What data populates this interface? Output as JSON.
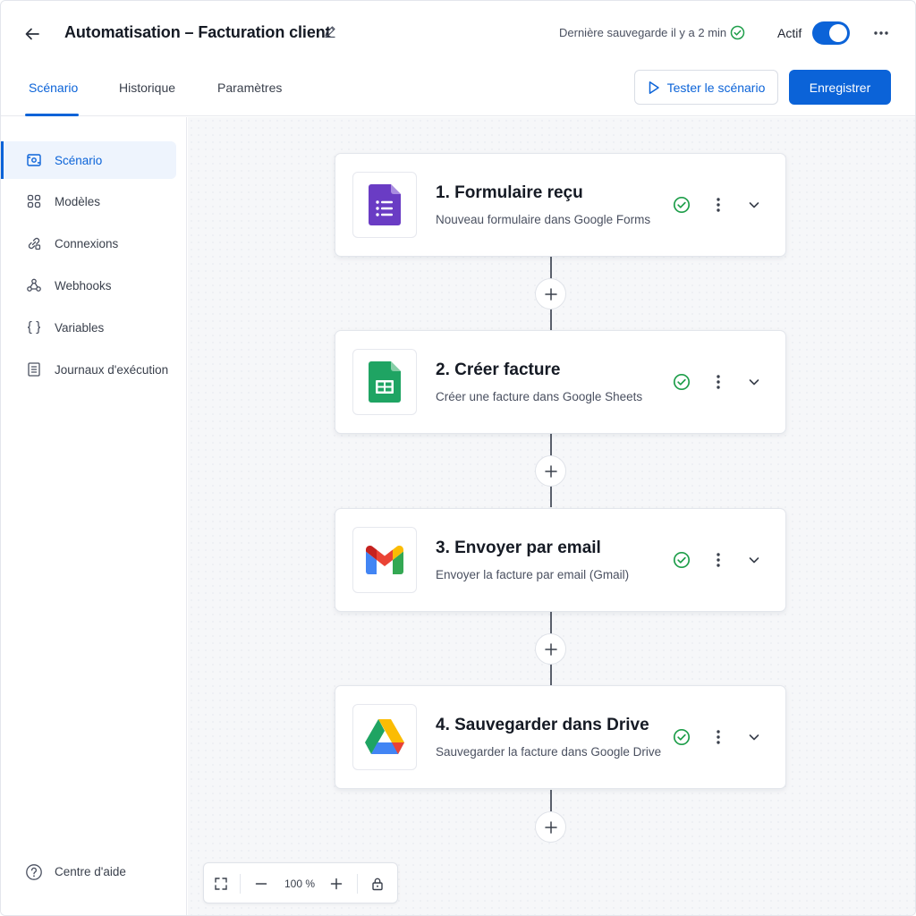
{
  "header": {
    "title": "Automatisation – Facturation client",
    "save_status": "Dernière sauvegarde il y a 2 min",
    "active_label": "Actif",
    "active_on": true
  },
  "tabs": [
    {
      "label": "Scénario",
      "active": true
    },
    {
      "label": "Historique",
      "active": false
    },
    {
      "label": "Paramètres",
      "active": false
    }
  ],
  "actions": {
    "test_label": "Tester le scénario",
    "save_label": "Enregistrer"
  },
  "sidebar": {
    "items": [
      {
        "label": "Scénario",
        "icon": "scenario-icon",
        "active": true
      },
      {
        "label": "Modèles",
        "icon": "grid-icon",
        "active": false
      },
      {
        "label": "Connexions",
        "icon": "link-icon",
        "active": false
      },
      {
        "label": "Webhooks",
        "icon": "webhook-icon",
        "active": false
      },
      {
        "label": "Variables",
        "icon": "braces-icon",
        "active": false
      },
      {
        "label": "Journaux d'exécution",
        "icon": "log-icon",
        "active": false
      }
    ],
    "help_label": "Centre d'aide"
  },
  "steps": [
    {
      "title": "1. Formulaire reçu",
      "description": "Nouveau formulaire dans Google Forms",
      "app": "google-forms-icon",
      "status": "ok"
    },
    {
      "title": "2. Créer facture",
      "description": "Créer une facture dans Google Sheets",
      "app": "google-sheets-icon",
      "status": "ok"
    },
    {
      "title": "3. Envoyer par email",
      "description": "Envoyer la facture par email (Gmail)",
      "app": "gmail-icon",
      "status": "ok"
    },
    {
      "title": "4. Sauvegarder dans Drive",
      "description": "Sauvegarder la facture dans Google Drive",
      "app": "google-drive-icon",
      "status": "ok"
    }
  ],
  "zoom": {
    "level": "100 %"
  },
  "colors": {
    "accent": "#0b63d8",
    "success": "#1e9e4a"
  }
}
